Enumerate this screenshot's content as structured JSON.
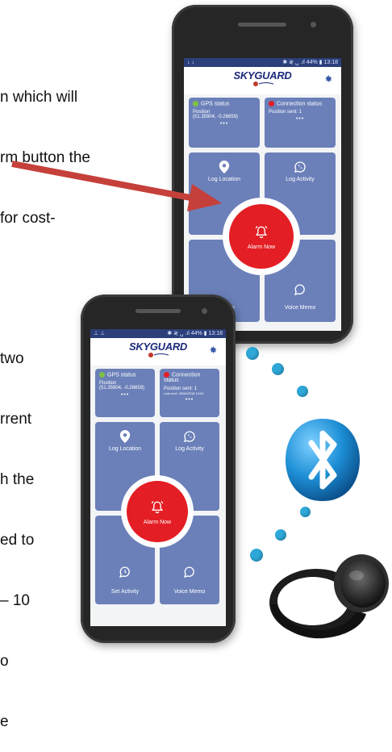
{
  "prose": {
    "top_lines": [
      "n which will",
      "rm button the",
      "for cost-"
    ],
    "mid_lines": [
      "two",
      "rrent",
      "h the",
      "ed to",
      "– 10",
      "o",
      "e"
    ]
  },
  "phone_back": {
    "status_left": "↓ ↓",
    "status_right": "✱ ≷ ␣ .ıl 44% ▮ 13:18",
    "brand": {
      "sky": "SKY",
      "guard": "GUARD",
      "tagline": "Partners in Personal\nSafety at Lone Worker"
    },
    "gps": {
      "title": "GPS status",
      "label": "Position",
      "value": "(51.35904, -0.26659)",
      "more": "•••"
    },
    "connection": {
      "title": "Connection status",
      "label": "Position sent: 1",
      "value": "",
      "more": "•••"
    },
    "tiles": {
      "log_location": "Log Location",
      "log_activity": "Log Activity",
      "set_activity": "t Activity",
      "voice_memo": "Voice Memo"
    },
    "alarm": "Alarm Now"
  },
  "phone_front": {
    "status_left": "⊥ ⊥",
    "status_right": "✱ ≷ ␣ .ıl 44% ▮ 13:18",
    "brand": {
      "sky": "SKY",
      "guard": "GUARD",
      "tagline": "Partners in Personal\nSafety at Lone Worker"
    },
    "gps": {
      "title": "GPS status",
      "label": "Position",
      "value": "(51.35904, -0.26659)",
      "more": "•••"
    },
    "connection": {
      "title": "Connection status",
      "label": "Position sent: 1",
      "value": "Last sent: 25/06/2018 13:00",
      "more": "•••"
    },
    "tiles": {
      "log_location": "Log Location",
      "log_activity": "Log Activity",
      "set_activity": "Set Activity",
      "voice_memo": "Voice Memo"
    },
    "alarm": "Alarm Now"
  },
  "colors": {
    "tile": "#6b80b9",
    "alarm": "#e31e24",
    "bluetooth": "#1d8fd6",
    "arrow": "#c5403a",
    "gps_dot": "#7dc142",
    "conn_dot": "#e31e24"
  },
  "icons": [
    "location-pin-icon",
    "whatsapp-icon",
    "alarm-bell-icon",
    "chat-clock-icon",
    "speech-bubble-icon",
    "gear-icon",
    "bluetooth-icon"
  ]
}
